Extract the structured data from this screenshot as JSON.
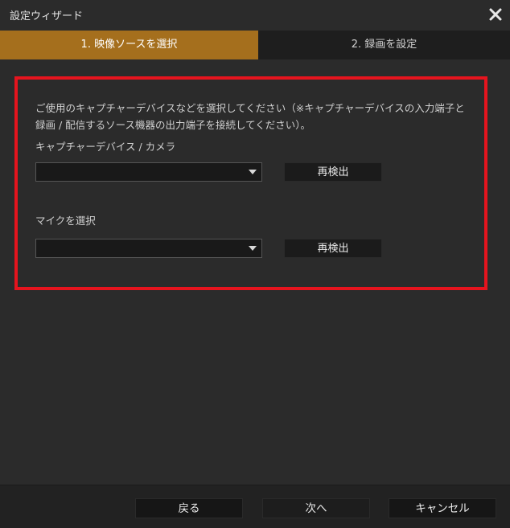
{
  "window": {
    "title": "設定ウィザード"
  },
  "tabs": [
    {
      "label": "1. 映像ソースを選択",
      "active": true
    },
    {
      "label": "2. 録画を設定",
      "active": false
    }
  ],
  "main": {
    "description_line1": "ご使用のキャプチャーデバイスなどを選択してください（※キャプチャーデバイスの入力端子と",
    "description_line2": "録画 / 配信するソース機器の出力端子を接続してください）。",
    "camera_label": "キャプチャーデバイス / カメラ",
    "camera_select_value": "",
    "camera_rescan_label": "再検出",
    "mic_label": "マイクを選択",
    "mic_select_value": "",
    "mic_rescan_label": "再検出"
  },
  "footer": {
    "back_label": "戻る",
    "next_label": "次へ",
    "cancel_label": "キャンセル"
  },
  "colors": {
    "active_tab": "#a56f1d",
    "highlight_border": "#e6141e",
    "background": "#2b2b2b"
  }
}
